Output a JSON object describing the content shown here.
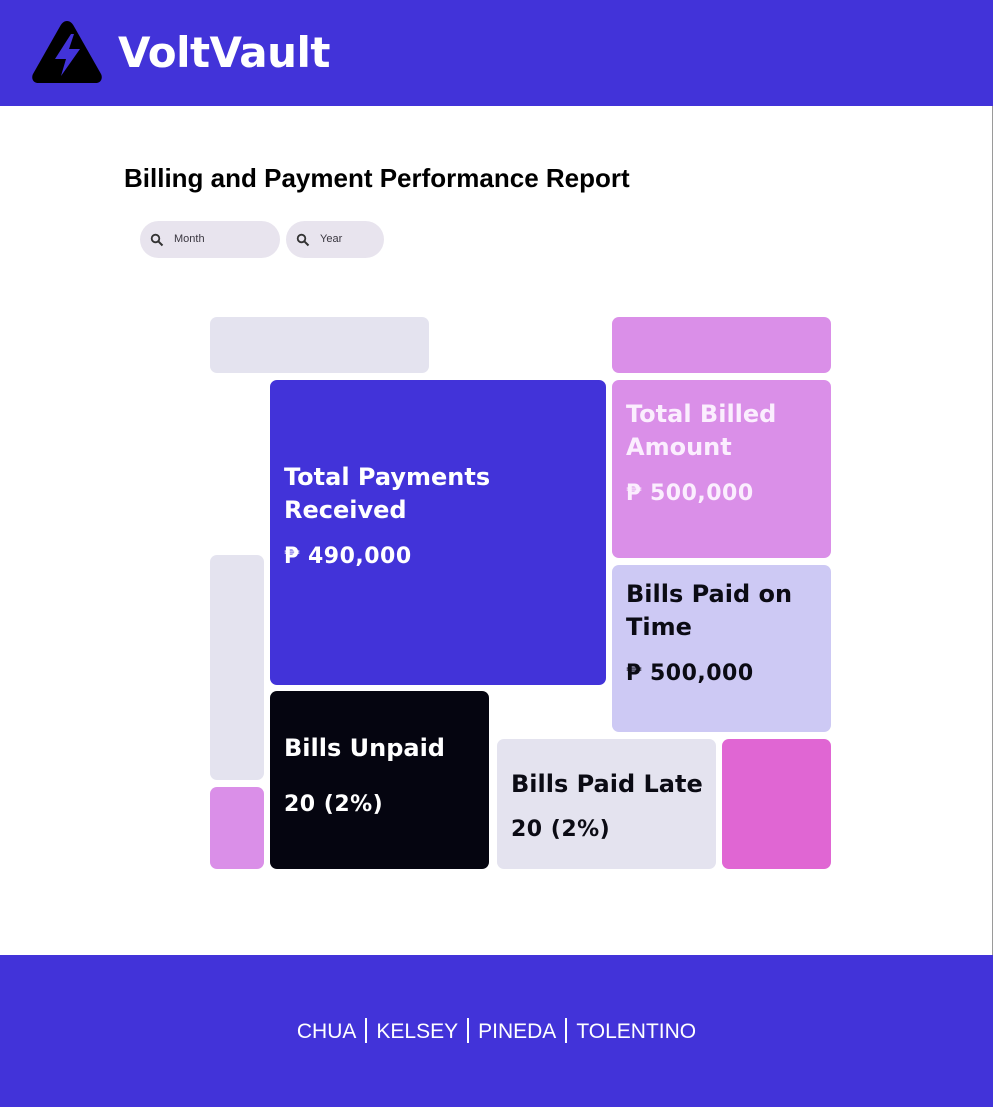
{
  "header": {
    "brand": "VoltVault",
    "logo_icon": "lightning-warning-icon",
    "background": "#4233d9"
  },
  "page": {
    "title": "Billing and Payment Performance Report"
  },
  "filters": {
    "month_placeholder": "Month",
    "year_placeholder": "Year",
    "icon": "search-icon"
  },
  "cards": {
    "total_payments": {
      "title": "Total Payments Received",
      "value": "₱ 490,000",
      "color": "#4233d9"
    },
    "total_billed": {
      "title": "Total Billed Amount",
      "value": "₱ 500,000",
      "color": "#da8fe8"
    },
    "paid_on_time": {
      "title": "Bills Paid on Time",
      "value": "₱ 500,000",
      "color": "#cdc9f4"
    },
    "unpaid": {
      "title": "Bills Unpaid",
      "value": "20 (2%)",
      "color": "#050510"
    },
    "paid_late": {
      "title": "Bills Paid Late",
      "value": "20 (2%)",
      "color": "#e4e3ef"
    }
  },
  "footer": {
    "credits": [
      "CHUA",
      "KELSEY",
      "PINEDA",
      "TOLENTINO"
    ]
  }
}
